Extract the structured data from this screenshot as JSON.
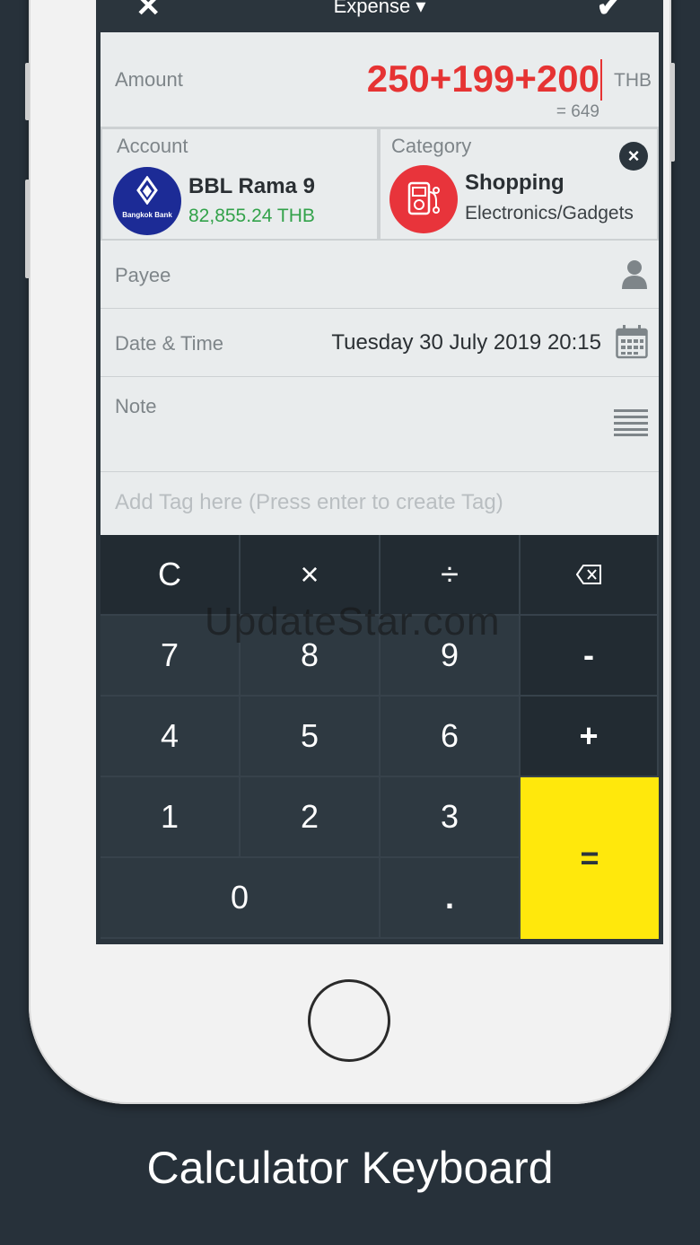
{
  "header": {
    "close_icon": "✕",
    "title": "Expense ▾",
    "confirm_icon": "✔"
  },
  "amount": {
    "label": "Amount",
    "expression": "250+199+200",
    "currency": "THB",
    "result": "= 649"
  },
  "account": {
    "label": "Account",
    "logo_text": "Bangkok Bank",
    "name": "BBL Rama 9",
    "balance": "82,855.24 THB",
    "balance_color": "#32a24a"
  },
  "category": {
    "label": "Category",
    "name": "Shopping",
    "subcategory": "Electronics/Gadgets",
    "clear_icon": "×"
  },
  "payee": {
    "label": "Payee"
  },
  "datetime": {
    "label": "Date & Time",
    "value": "Tuesday 30 July 2019 20:15"
  },
  "note": {
    "label": "Note"
  },
  "tags": {
    "placeholder": "Add Tag here (Press enter to create Tag)"
  },
  "keypad": {
    "clear": "C",
    "multiply": "×",
    "divide": "÷",
    "backspace": "⌫",
    "k7": "7",
    "k8": "8",
    "k9": "9",
    "minus": "-",
    "k4": "4",
    "k5": "5",
    "k6": "6",
    "plus": "+",
    "k1": "1",
    "k2": "2",
    "k3": "3",
    "equals": "=",
    "k0": "0",
    "dot": "."
  },
  "watermark": "UpdateStar.com",
  "caption": "Calculator Keyboard",
  "colors": {
    "accent_red": "#e63333",
    "equals_yellow": "#ffe80c",
    "dark": "#2b353d"
  }
}
